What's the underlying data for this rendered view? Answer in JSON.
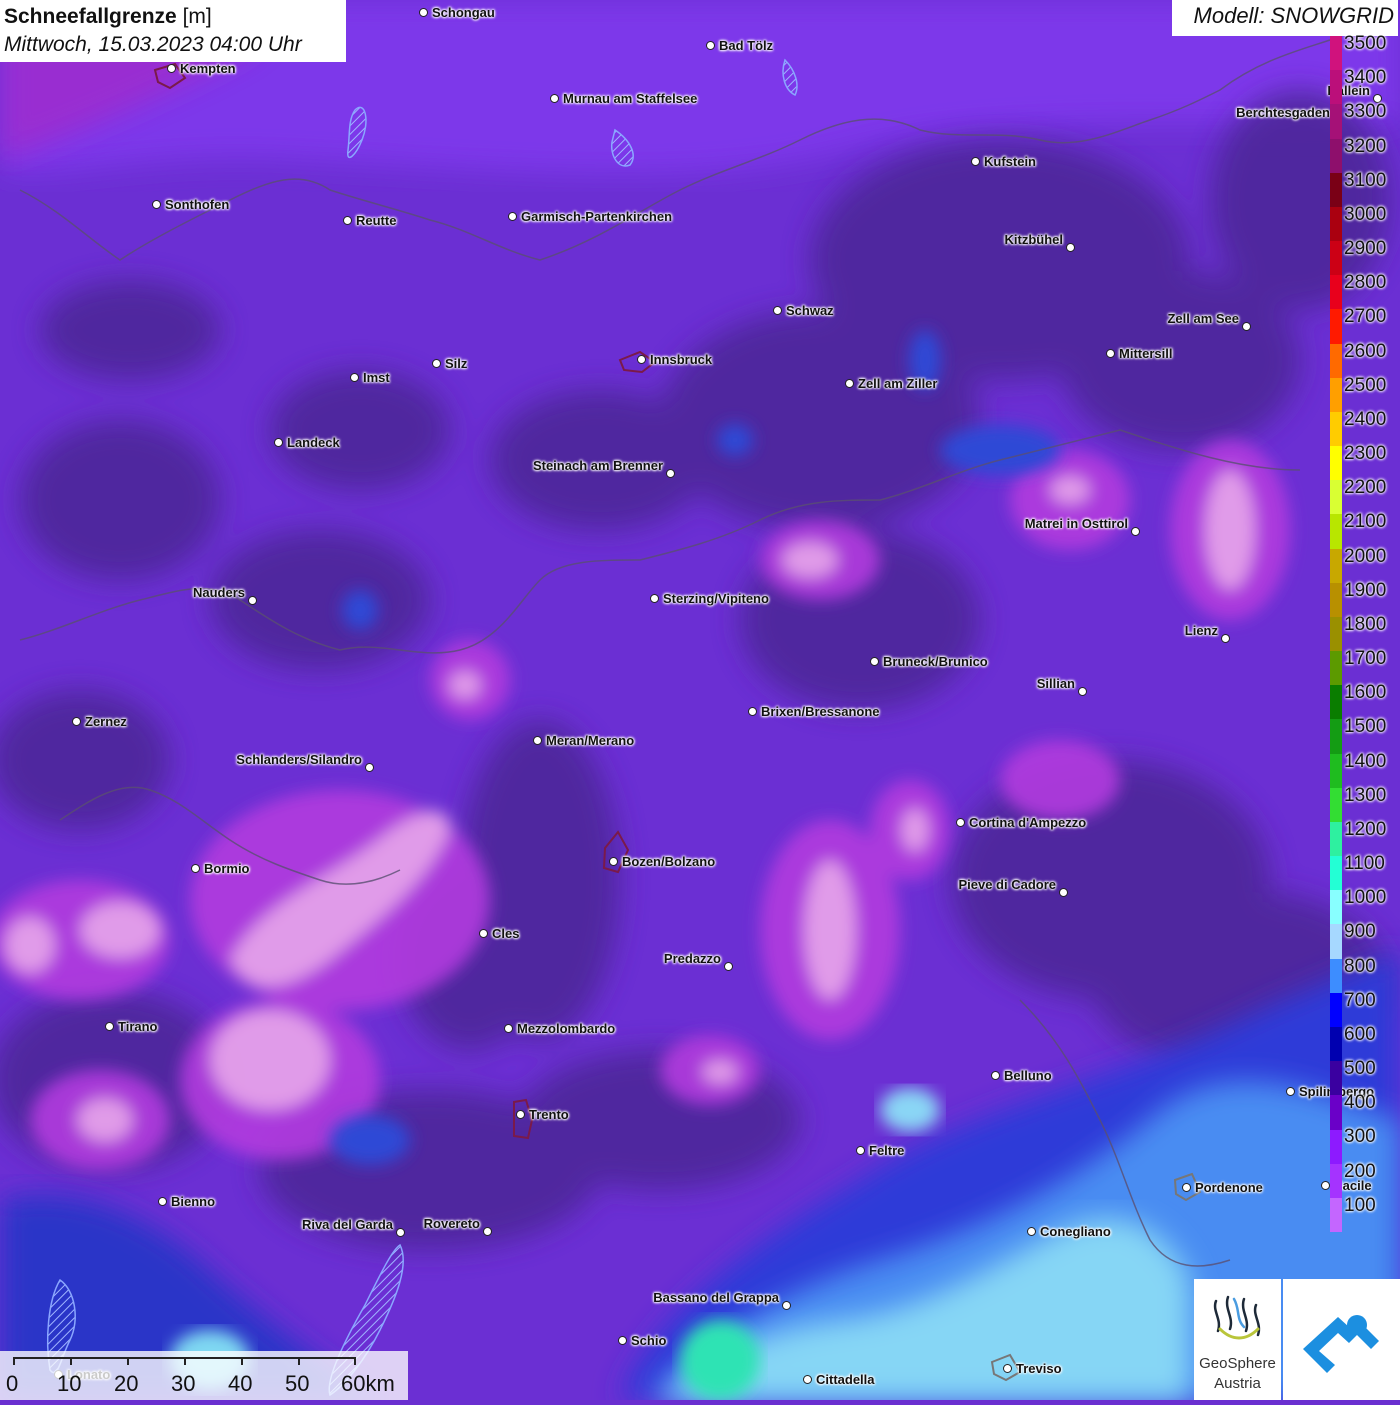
{
  "title": {
    "parameter": "Schneefallgrenze",
    "unit": "[m]",
    "datetime": "Mittwoch, 15.03.2023 04:00 Uhr"
  },
  "model_label": "Modell: SNOWGRID",
  "legend": {
    "labels": [
      "3500",
      "3400",
      "3300",
      "3200",
      "3100",
      "3000",
      "2900",
      "2800",
      "2700",
      "2600",
      "2500",
      "2400",
      "2300",
      "2200",
      "2100",
      "2000",
      "1900",
      "1800",
      "1700",
      "1600",
      "1500",
      "1400",
      "1300",
      "1200",
      "1100",
      "1000",
      "900",
      "800",
      "700",
      "600",
      "500",
      "400",
      "300",
      "200",
      "100"
    ],
    "colors": [
      "#d0127d",
      "#bb0f7a",
      "#a51177",
      "#8e0f6c",
      "#7a0016",
      "#aa0010",
      "#cc0015",
      "#e8001c",
      "#ff1a00",
      "#ff6a00",
      "#ff9f00",
      "#ffcc00",
      "#ffff00",
      "#d9ff33",
      "#b8e600",
      "#c8a800",
      "#b89000",
      "#9a9000",
      "#5c9a00",
      "#0a7d00",
      "#149c14",
      "#1fbc1f",
      "#33dd33",
      "#2ef0a0",
      "#23ffd5",
      "#88ffff",
      "#a6d8ff",
      "#3d8dff",
      "#0000ff",
      "#0000b0",
      "#3a00a0",
      "#6a00c8",
      "#8d1aff",
      "#a533ff",
      "#c466ff"
    ]
  },
  "cities": [
    {
      "name": "Schongau"
    },
    {
      "name": "Kempten"
    },
    {
      "name": "Bad Tölz"
    },
    {
      "name": "Murnau am Staffelsee"
    },
    {
      "name": "Hallein"
    },
    {
      "name": "Berchtesgaden"
    },
    {
      "name": "Kufstein"
    },
    {
      "name": "Sonthofen"
    },
    {
      "name": "Reutte"
    },
    {
      "name": "Garmisch-Partenkirchen"
    },
    {
      "name": "Kitzbühel"
    },
    {
      "name": "Schwaz"
    },
    {
      "name": "Zell am See"
    },
    {
      "name": "Mittersill"
    },
    {
      "name": "Innsbruck"
    },
    {
      "name": "Silz"
    },
    {
      "name": "Imst"
    },
    {
      "name": "Zell am Ziller"
    },
    {
      "name": "Landeck"
    },
    {
      "name": "Steinach am Brenner"
    },
    {
      "name": "Matrei in Osttirol"
    },
    {
      "name": "Nauders"
    },
    {
      "name": "Sterzing/Vipiteno"
    },
    {
      "name": "Lienz"
    },
    {
      "name": "Bruneck/Brunico"
    },
    {
      "name": "Sillian"
    },
    {
      "name": "Brixen/Bressanone"
    },
    {
      "name": "Zernez"
    },
    {
      "name": "Meran/Merano"
    },
    {
      "name": "Schlanders/Silandro"
    },
    {
      "name": "Cortina d'Ampezzo"
    },
    {
      "name": "Bozen/Bolzano"
    },
    {
      "name": "Bormio"
    },
    {
      "name": "Pieve di Cadore"
    },
    {
      "name": "Cles"
    },
    {
      "name": "Predazzo"
    },
    {
      "name": "Tirano"
    },
    {
      "name": "Mezzolombardo"
    },
    {
      "name": "Belluno"
    },
    {
      "name": "Spilimbergo"
    },
    {
      "name": "Trento"
    },
    {
      "name": "Feltre"
    },
    {
      "name": "Pordenone"
    },
    {
      "name": "Bienno"
    },
    {
      "name": "Riva del Garda"
    },
    {
      "name": "Rovereto"
    },
    {
      "name": "Conegliano"
    },
    {
      "name": "Bassano del Grappa"
    },
    {
      "name": "Schio"
    },
    {
      "name": "Treviso"
    },
    {
      "name": "Cittadella"
    },
    {
      "name": "Lonato"
    },
    {
      "name": "Sacile"
    }
  ],
  "scalebar": {
    "labels": [
      "0",
      "10",
      "20",
      "30",
      "40",
      "50",
      "60km"
    ]
  },
  "logo": {
    "line1": "GeoSphere",
    "line2": "Austria"
  }
}
